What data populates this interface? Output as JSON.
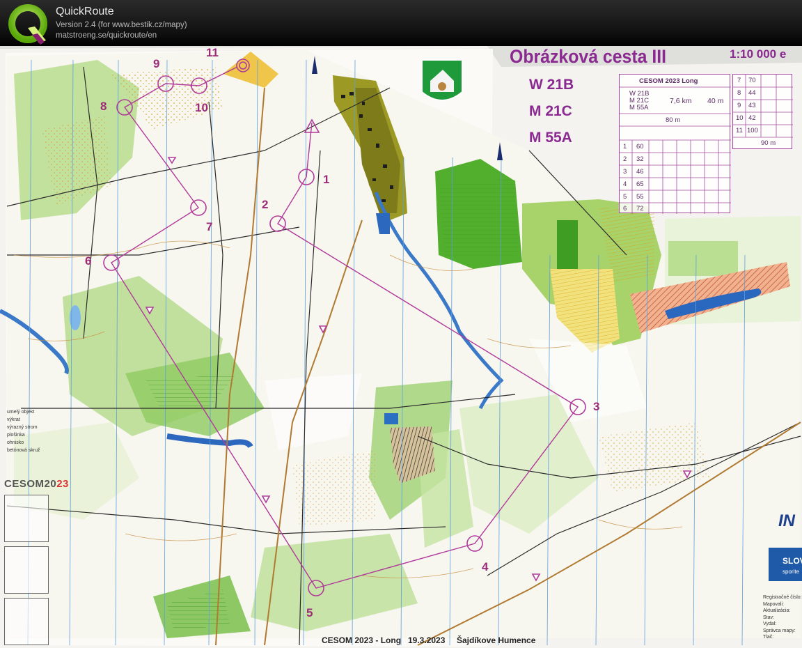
{
  "app": {
    "name": "QuickRoute",
    "version": "Version 2.4  (for www.bestik.cz/mapy)",
    "url": "matstroeng.se/quickroute/en"
  },
  "map": {
    "title": "Obrázková cesta III",
    "scale": "1:10 000 e",
    "categories": [
      "W 21B",
      "M 21C",
      "M 55A"
    ],
    "controls": [
      "1",
      "2",
      "3",
      "4",
      "5",
      "6",
      "7",
      "8",
      "9",
      "10",
      "11"
    ],
    "description": {
      "event": "CESOM 2023 Long",
      "classes": [
        "W 21B",
        "M 21C",
        "M 55A"
      ],
      "length": "7,6 km",
      "climb": "40 m",
      "start_dist": "80 m",
      "finish_dist": "90 m",
      "rows": [
        {
          "n": "1",
          "code": "60"
        },
        {
          "n": "2",
          "code": "32"
        },
        {
          "n": "3",
          "code": "46"
        },
        {
          "n": "4",
          "code": "65"
        },
        {
          "n": "5",
          "code": "55"
        },
        {
          "n": "6",
          "code": "72"
        }
      ],
      "rows_right": [
        {
          "n": "7",
          "code": "70"
        },
        {
          "n": "8",
          "code": "44"
        },
        {
          "n": "9",
          "code": "43"
        },
        {
          "n": "10",
          "code": "42"
        },
        {
          "n": "11",
          "code": "100"
        }
      ]
    },
    "legend": [
      "umelý objekt",
      "výkrat",
      "výrazný strom",
      "plošinka",
      "ohnisko",
      "betónová skruž"
    ],
    "logo": {
      "prefix": "CESOM20",
      "suffix": "23"
    },
    "footer": {
      "event": "CESOM 2023 - Long",
      "date": "19.3.2023",
      "place": "Šajdíkove Humence"
    },
    "registration": [
      "Registračné číslo:",
      "Mapovali:",
      "Aktualizácia:",
      "Stav:",
      "Vydal:",
      "Správca mapy:",
      "Tlač:"
    ],
    "sponsor": {
      "text": "SLOV",
      "sub": "sporite"
    },
    "sponsor2": "IN"
  },
  "colors": {
    "course": "#b03a9a",
    "forest_green": "#55b030",
    "light_green": "#a9d77b",
    "open_yellow": "#f3d35a",
    "water": "#2a6fc2",
    "brown": "#b07a32"
  }
}
